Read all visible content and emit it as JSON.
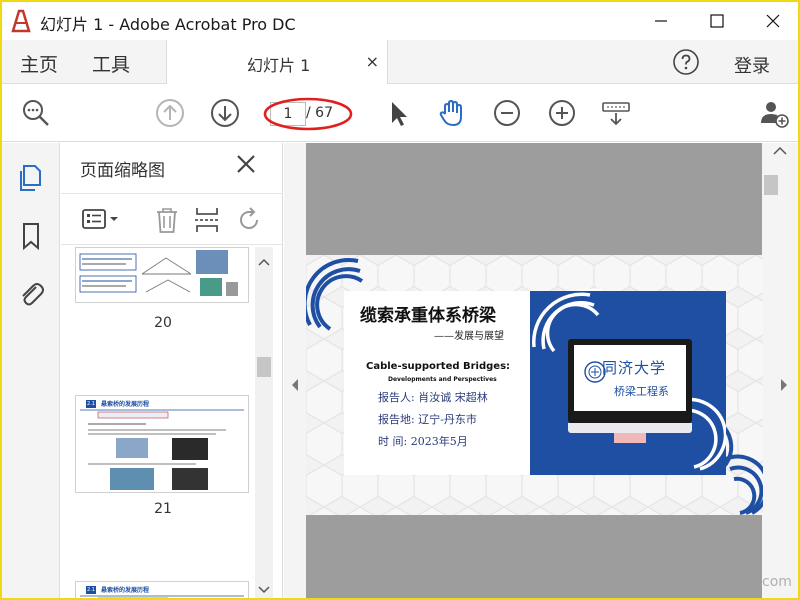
{
  "window": {
    "title": "幻灯片 1 - Adobe Acrobat Pro DC",
    "minimize_glyph": "—",
    "maximize_glyph": "☐",
    "close_glyph": "✕"
  },
  "tabs": {
    "home": "主页",
    "tools": "工具",
    "document": "幻灯片 1",
    "document_close": "×",
    "login": "登录"
  },
  "toolbar": {
    "current_page": "1",
    "total_pages": "/ 67",
    "icons": [
      "search-zoom-icon",
      "prev-page-icon",
      "next-page-icon",
      "select-cursor-icon",
      "hand-tool-icon",
      "zoom-out-icon",
      "zoom-in-icon",
      "keyboard-icon",
      "add-user-icon"
    ],
    "highlight_color": "#e0201e",
    "accent_color": "#2b6cc4"
  },
  "rail": {
    "icons": [
      "page-thumbnails-icon",
      "bookmark-icon",
      "attachment-icon"
    ]
  },
  "thumbnails": {
    "title": "页面缩略图",
    "close": "✕",
    "pages": [
      {
        "number": "20"
      },
      {
        "number": "21",
        "heading_num": "2.1",
        "heading": "悬索桥的发展历程"
      },
      {
        "heading_num": "2.1",
        "heading": "悬索桥的发展历程"
      }
    ]
  },
  "slide": {
    "title": "缆索承重体系桥梁",
    "subtitle": "——发展与展望",
    "english_title": "Cable-supported Bridges:",
    "english_subtitle": "Developments and Perspectives",
    "reporter": "报告人: 肖汝诚  宋超林",
    "location": "报告地: 辽宁-丹东市",
    "date": "时  间: 2023年5月",
    "university": "同济大学",
    "department": "桥梁工程系",
    "brand_color": "#1e4fa3"
  },
  "watermark": "com"
}
